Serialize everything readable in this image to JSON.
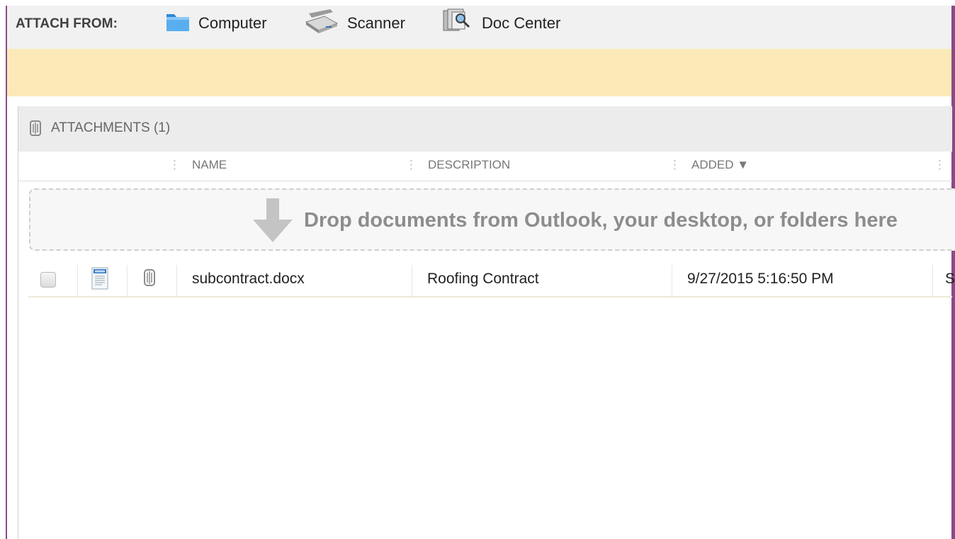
{
  "toolbar": {
    "label": "ATTACH FROM:",
    "sources": [
      {
        "label": "Computer",
        "icon": "folder-icon"
      },
      {
        "label": "Scanner",
        "icon": "scanner-icon"
      },
      {
        "label": "Doc Center",
        "icon": "doc-center-icon"
      }
    ]
  },
  "panel": {
    "title": "ATTACHMENTS (1)",
    "columns": {
      "name": "NAME",
      "description": "DESCRIPTION",
      "added": "ADDED ▼"
    },
    "dropzone_text": "Drop documents from Outlook, your desktop, or folders here",
    "rows": [
      {
        "name": "subcontract.docx",
        "description": "Roofing Contract",
        "added": "9/27/2015 5:16:50 PM",
        "extra": "S"
      }
    ]
  },
  "colors": {
    "notice_bg": "#fbeab7",
    "frame": "#8a4a8a",
    "header_bg": "#ececec"
  }
}
